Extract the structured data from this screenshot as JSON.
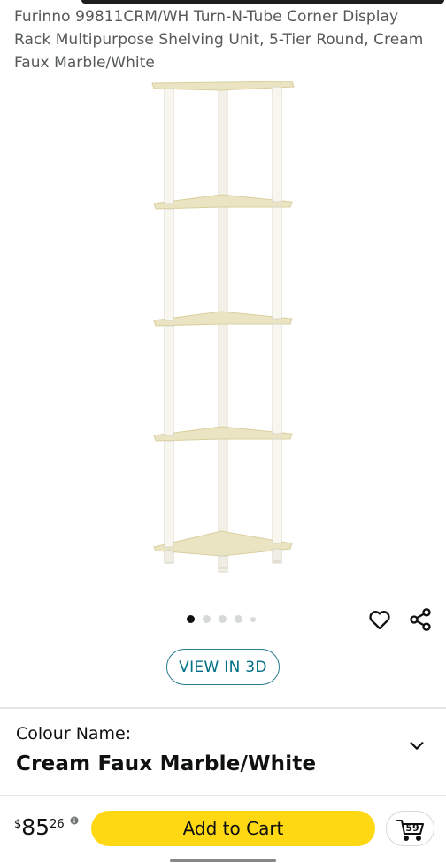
{
  "product": {
    "title": "Furinno 99811CRM/WH Turn-N-Tube Corner Display Rack Multipurpose Shelving Unit, 5-Tier Round, Cream Faux Marble/White",
    "image_icon": "corner-shelf-image"
  },
  "gallery": {
    "dot_count": 5,
    "active_index": 0
  },
  "actions": {
    "view_3d_label": "VIEW IN 3D",
    "favorite_icon": "heart-icon",
    "share_icon": "share-icon"
  },
  "variation": {
    "label": "Colour Name:",
    "value": "Cream Faux Marble/White",
    "expand_icon": "chevron-down-icon"
  },
  "buy_bar": {
    "price_symbol": "$",
    "price_whole": "85",
    "price_fraction": "26",
    "info_icon": "info-icon",
    "add_to_cart_label": "Add to Cart",
    "cart_count": "59",
    "cart_icon": "cart-icon"
  },
  "colors": {
    "accent_teal": "#007185",
    "add_to_cart_yellow": "#FFD814",
    "text_primary": "#0F1111",
    "text_secondary": "#565959"
  }
}
